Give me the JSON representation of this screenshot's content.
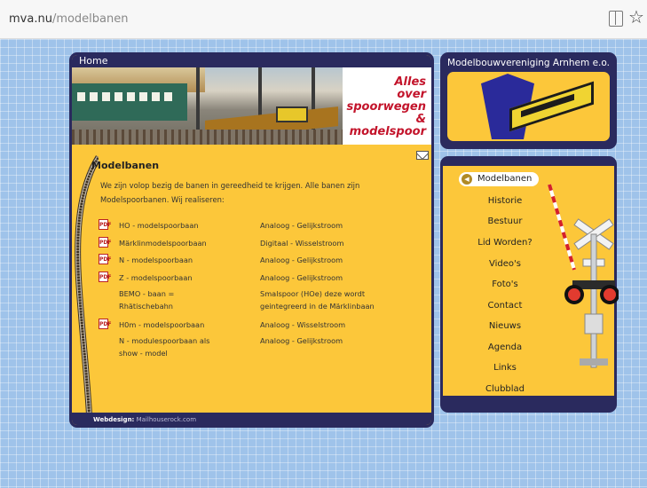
{
  "browser": {
    "url_domain": "mva.nu",
    "url_path": "/modelbanen"
  },
  "main": {
    "tab_label": "Home",
    "slogan_lines": [
      "Alles",
      "over",
      "spoorwegen",
      "&",
      "modelspoor"
    ],
    "title": "Modelbanen",
    "intro": "We zijn volop bezig de banen in gereedheid te krijgen. Alle banen zijn Modelspoorbanen. Wij realiseren:",
    "rows": [
      {
        "name": "HO - modelspoorbaan",
        "type": "Analoog - Gelijkstroom",
        "pdf": true
      },
      {
        "name": "Märklinmodelspoorbaan",
        "type": "Digitaal - Wisselstroom",
        "pdf": true
      },
      {
        "name": "N - modelspoorbaan",
        "type": "Analoog - Gelijkstroom",
        "pdf": true
      },
      {
        "name": "Z - modelspoorbaan",
        "type": "Analoog - Gelijkstroom",
        "pdf": true
      },
      {
        "name": "BEMO - baan = Rhätischebahn",
        "type": "Smalspoor (HOe)  deze wordt geintegreerd in de Märklinbaan",
        "pdf": false
      },
      {
        "name": "H0m - modelspoorbaan",
        "type": "Analoog - Wisselstroom",
        "pdf": true
      },
      {
        "name": "N - modulespoorbaan als show - model",
        "type": "Analoog - Gelijkstroom",
        "pdf": false
      }
    ],
    "footer_label": "Webdesign:",
    "footer_link": "Mailhouserock.com"
  },
  "club": {
    "title": "Modelbouwvereniging Arnhem e.o."
  },
  "nav": {
    "active": "Modelbanen",
    "items": [
      "Historie",
      "Bestuur",
      "Lid Worden?",
      "Video's",
      "Foto's",
      "Contact",
      "Nieuws",
      "Agenda",
      "Links",
      "Clubblad"
    ]
  },
  "icons": {
    "mail": "mail-icon",
    "pdf": "pdf-icon",
    "reader": "reader-view-icon",
    "bookmark": "star-icon",
    "arrow": "arrow-left-icon"
  },
  "colors": {
    "navy": "#2a2a5e",
    "yellow": "#fcc73a",
    "slogan_red": "#c3142b",
    "background_blue": "#9fc3ea"
  }
}
